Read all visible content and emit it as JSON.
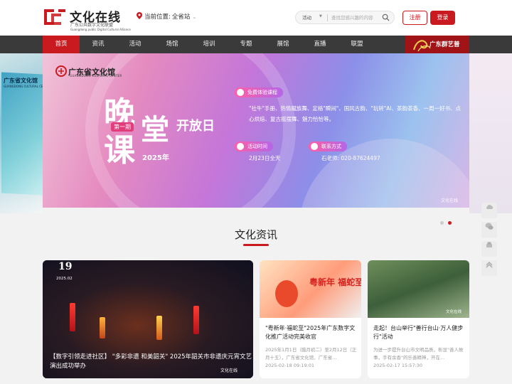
{
  "header": {
    "logo_title": "文化在线",
    "logo_sub": "广东公共数字文化联盟",
    "logo_en": "Guangdong public Digital Cultural Alliance",
    "location_label": "当前位置:",
    "location_value": "全省站",
    "search_category": "活动",
    "search_placeholder": "查找您感兴趣的内容",
    "register_label": "注册",
    "login_label": "登录"
  },
  "nav": {
    "items": [
      {
        "label": "首页",
        "active": true
      },
      {
        "label": "资讯"
      },
      {
        "label": "活动"
      },
      {
        "label": "场馆"
      },
      {
        "label": "培训"
      },
      {
        "label": "专题"
      },
      {
        "label": "展馆"
      },
      {
        "label": "直播"
      },
      {
        "label": "联盟"
      }
    ],
    "brand_label": "广东群艺普"
  },
  "banner": {
    "side_left_label": "广东省文化馆",
    "side_left_en": "GUANGDONG CULTURAL CENTER",
    "logo_cn": "广东省文化馆",
    "logo_en": "GUANGDONG CULTURAL CENTER",
    "title_char1": "晚",
    "title_char2": "课",
    "title_char3": "堂",
    "issue": "第一期",
    "open_day": "开放日",
    "year": "2025年",
    "pill_free": "免费体验课程",
    "desc": "\"社牛\"手册、热情蹴族舞、定格\"瞬间\"、国风古韵、\"玩转\"AI、茶韵茶香、一周一好书、点心烘焙、复古摇摆舞、魅力恰恰等。",
    "pill_time": "活动时间",
    "time_value": "2月23日全天",
    "pill_contact": "联系方式",
    "contact_value": "石老师: 020-87624497",
    "watermark": "文化在线",
    "slide_count": 2,
    "active_slide": 2
  },
  "section": {
    "title": "文化资讯"
  },
  "news": {
    "feature": {
      "day": "19",
      "ym": "2025.02",
      "caption": "【数字引领走进社区】 \"多彩非遗 和美韶关\" 2025年韶关市非遗庆元宵文艺演出成功举办",
      "watermark": "文化在线"
    },
    "cards": [
      {
        "title": "\"粤新年·福蛇至\"2025年广东数字文化推广活动完美收官",
        "desc": "2025年1月1日（腊月初二）至2月12日（正月十五），广东省文化馆、广东省...",
        "time": "2025-02-18 09:19:01",
        "img_text": "粤新年 福蛇至"
      },
      {
        "title": "走起！台山举行\"善行台山·万人健步行\"活动",
        "desc": "为进一步提升台山市文明品质，彰显\"善人故事，手有余香\"的乐善精神，开在...",
        "time": "2025-02-17 15:57:30",
        "img_text": "文化在线"
      }
    ]
  },
  "colors": {
    "brand_red": "#c81a1f",
    "nav_bg": "#3a3a3a"
  }
}
